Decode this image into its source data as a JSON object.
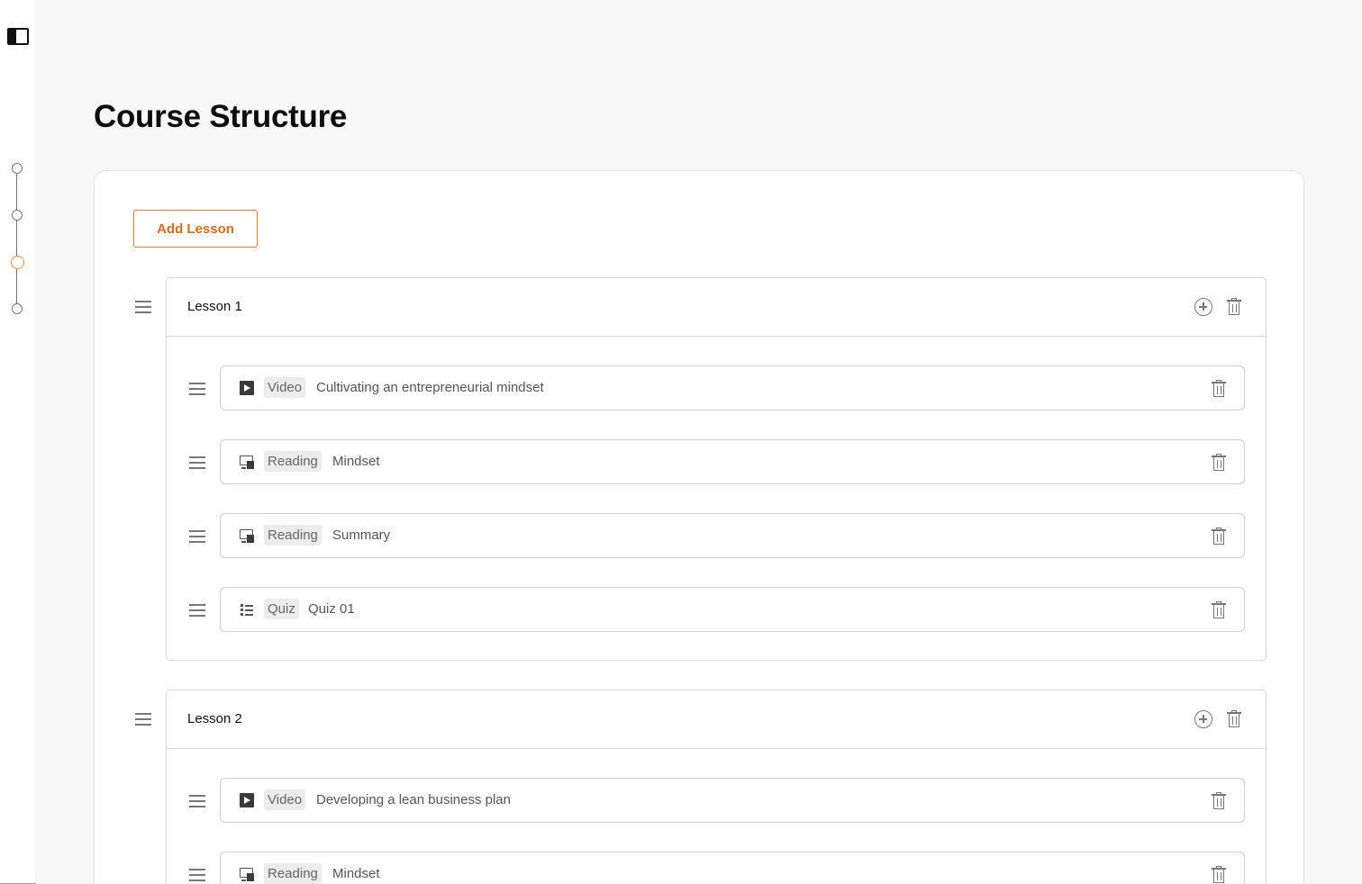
{
  "page": {
    "title": "Course Structure"
  },
  "actions": {
    "add_lesson_label": "Add Lesson"
  },
  "colors": {
    "accent": "#e07a3a",
    "text": "#111111",
    "muted": "#777777"
  },
  "stepper": {
    "steps": 4,
    "active_step": 3
  },
  "lessons": [
    {
      "title": "Lesson 1",
      "items": [
        {
          "type": "Video",
          "icon": "play-icon",
          "title": "Cultivating an entrepreneurial mindset"
        },
        {
          "type": "Reading",
          "icon": "reading-icon",
          "title": "Mindset"
        },
        {
          "type": "Reading",
          "icon": "reading-icon",
          "title": "Summary"
        },
        {
          "type": "Quiz",
          "icon": "quiz-list-icon",
          "title": "Quiz 01"
        }
      ]
    },
    {
      "title": "Lesson 2",
      "items": [
        {
          "type": "Video",
          "icon": "play-icon",
          "title": "Developing a lean business plan"
        },
        {
          "type": "Reading",
          "icon": "reading-icon",
          "title": "Mindset"
        }
      ]
    }
  ]
}
